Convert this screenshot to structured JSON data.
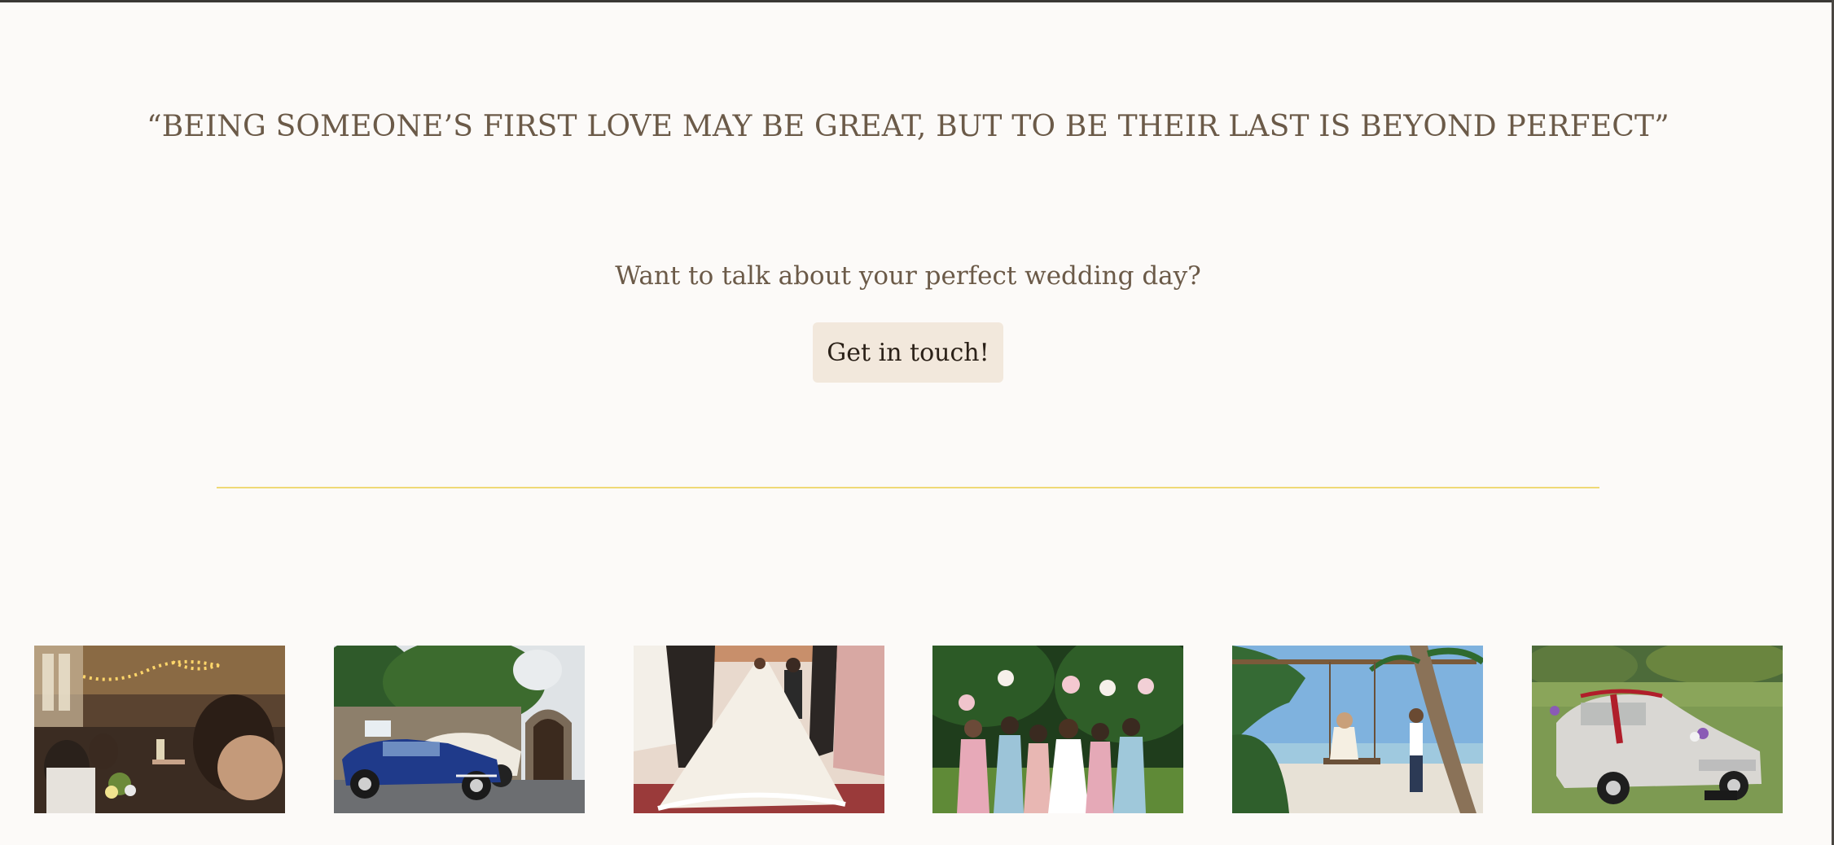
{
  "quote": {
    "text": "“BEING SOMEONE’S FIRST LOVE MAY BE GREAT, BUT TO BE THEIR LAST IS BEYOND PERFECT”"
  },
  "contact": {
    "prompt": "Want to talk about your perfect wedding day?",
    "button_label": "Get in touch!"
  },
  "colors": {
    "background": "#fcfaf8",
    "text": "#6b5a48",
    "button_bg": "#f2e8dc",
    "divider": "#efd976"
  },
  "gallery": {
    "images": [
      {
        "name": "reception-toast-photo"
      },
      {
        "name": "vintage-wedding-cars-photo"
      },
      {
        "name": "bride-veil-ceremony-photo"
      },
      {
        "name": "bridesmaids-bouquets-photo"
      },
      {
        "name": "beach-swing-couple-photo"
      },
      {
        "name": "white-wedding-car-photo"
      }
    ]
  }
}
